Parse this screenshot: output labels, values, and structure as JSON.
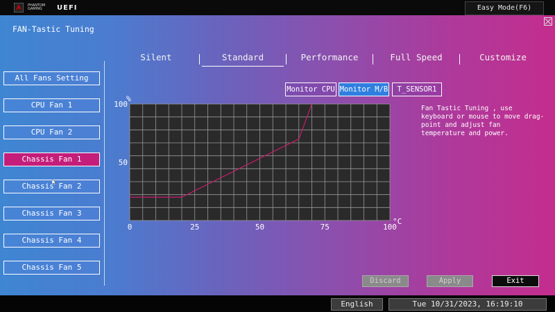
{
  "header": {
    "brand_line1": "PHANTOM GAMING",
    "brand_line2": "UEFI",
    "easy_mode_label": "Easy Mode(F6)"
  },
  "page": {
    "title": "FAN-Tastic Tuning"
  },
  "tabs": [
    {
      "label": "Silent"
    },
    {
      "label": "Standard"
    },
    {
      "label": "Performance"
    },
    {
      "label": "Full Speed"
    },
    {
      "label": "Customize"
    }
  ],
  "fans": [
    {
      "label": "All Fans Setting"
    },
    {
      "label": "CPU Fan 1"
    },
    {
      "label": "CPU Fan 2"
    },
    {
      "label": "Chassis Fan 1"
    },
    {
      "label": "Chassis Fan 2"
    },
    {
      "label": "Chassis Fan 3"
    },
    {
      "label": "Chassis Fan 4"
    },
    {
      "label": "Chassis Fan 5"
    }
  ],
  "selected_fan": "Chassis Fan 1",
  "selected_tab": "Standard",
  "monitors": [
    {
      "label": "Monitor CPU"
    },
    {
      "label": "Monitor M/B"
    },
    {
      "label": "T_SENSOR1"
    }
  ],
  "selected_monitor": "Monitor M/B",
  "help_text": "Fan Tastic Tuning , use keyboard or mouse to move drag-point and adjust fan temperature and power.",
  "chart_data": {
    "type": "line",
    "x_unit": "°C",
    "y_unit": "%",
    "xlim": [
      0,
      100
    ],
    "ylim": [
      0,
      100
    ],
    "x_ticks": [
      0,
      25,
      50,
      75,
      100
    ],
    "y_ticks": [
      50,
      100
    ],
    "grid": true,
    "series": [
      {
        "x": [
          0,
          20,
          65,
          70
        ],
        "y": [
          20,
          20,
          70,
          100
        ]
      }
    ]
  },
  "actions": {
    "discard": "Discard",
    "apply": "Apply",
    "exit": "Exit"
  },
  "footer": {
    "language": "English",
    "datetime": "Tue 10/31/2023, 16:19:10"
  },
  "colors": {
    "active_fan": "#c41d7a",
    "active_monitor": "#2f7fe0",
    "curve": "#c81d6e"
  }
}
